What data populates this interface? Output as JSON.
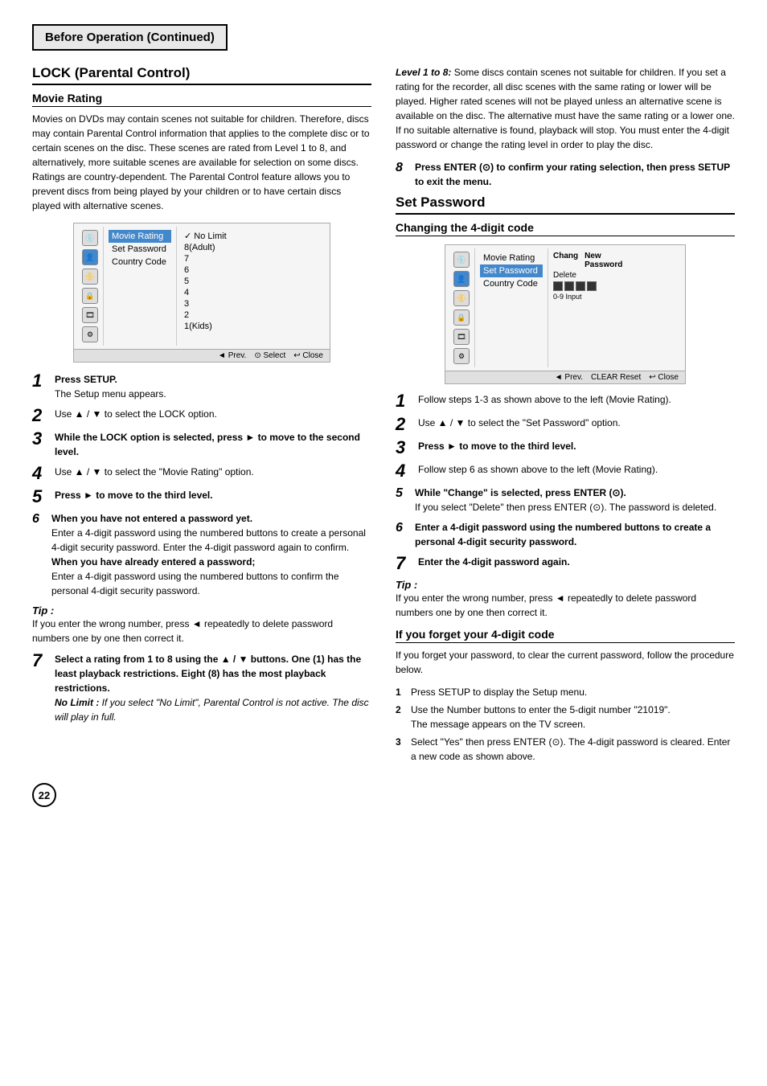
{
  "header": {
    "title": "Before Operation (Continued)"
  },
  "left_col": {
    "section_title": "LOCK (Parental Control)",
    "sub_section_title": "Movie Rating",
    "intro_text": "Movies on DVDs may contain scenes not suitable for children. Therefore, discs may contain Parental Control information that applies to the complete disc or to certain scenes on the disc. These scenes are rated from Level 1 to 8, and alternatively, more suitable scenes are available for selection on some discs. Ratings are country-dependent. The Parental Control feature allows you to prevent discs from being played by your children or to have certain discs played with alternative scenes.",
    "menu": {
      "icons": [
        "disc",
        "person",
        "cd",
        "lock",
        "film",
        "gear"
      ],
      "items": [
        "Movie Rating",
        "Set Password",
        "Country Code"
      ],
      "sub_items": [
        "No Limit",
        "8(Adult)",
        "7",
        "6",
        "5",
        "4",
        "3",
        "2",
        "1(Kids)"
      ],
      "checked_item": "No Limit",
      "bar_items": [
        "◄ Prev.",
        "⊙ Select",
        "↩ Close"
      ]
    },
    "steps": [
      {
        "num": "1",
        "bold": "Press SETUP.",
        "text": "The Setup menu appears."
      },
      {
        "num": "2",
        "text": "Use ▲ / ▼ to select the LOCK option."
      },
      {
        "num": "3",
        "text": "While the LOCK option is selected, press ► to move to the second level."
      },
      {
        "num": "4",
        "text": "Use ▲ / ▼ to select the \"Movie Rating\" option."
      },
      {
        "num": "5",
        "text": "Press ► to move to the third level."
      },
      {
        "num": "6",
        "bold_intro": "When you have not entered a password yet.",
        "text": "Enter a 4-digit password using the numbered buttons to create a personal 4-digit security password. Enter the 4-digit password again to confirm.",
        "bold_alt": "When you have already entered a password;",
        "text_alt": "Enter a 4-digit password using the numbered buttons to confirm the personal 4-digit security password."
      },
      {
        "num": "7",
        "text": "Select a rating from 1 to 8 using the ▲ / ▼ buttons. One (1) has the least playback restrictions. Eight (8) has the most playback restrictions.",
        "note_bold": "No Limit :",
        "note_text": " If you select \"No Limit\", Parental Control is not active. The disc will play in full."
      }
    ],
    "tip": {
      "title": "Tip :",
      "text": "If you enter the wrong number, press ◄ repeatedly to delete password numbers one by one then correct it."
    }
  },
  "right_col": {
    "level_text": "Level 1 to 8: Some discs contain scenes not suitable for children. If you set a rating for the recorder, all disc scenes with the same rating or lower will be played. Higher rated scenes will not be played unless an alternative scene is available on the disc. The alternative must have the same rating or a lower one. If no suitable alternative is found, playback will stop. You must enter the 4-digit password or change the rating level in order to play the disc.",
    "step8": {
      "num": "8",
      "text": "Press ENTER (⊙) to confirm your rating selection, then press SETUP to exit the menu."
    },
    "set_password_title": "Set Password",
    "changing_title": "Changing the 4-digit code",
    "pwd_menu": {
      "items": [
        "Movie Rating",
        "Set Password",
        "Country Code"
      ],
      "sub_items": [
        "Change",
        "Delete"
      ],
      "new_password_label": "New Password",
      "input_squares": 4,
      "hint": "0-9 Input",
      "bar_items": [
        "◄ Prev.",
        "CLEAR Reset",
        "↩ Close"
      ]
    },
    "steps": [
      {
        "num": "1",
        "text": "Follow steps 1-3 as shown above to the left (Movie Rating)."
      },
      {
        "num": "2",
        "text": "Use ▲ / ▼ to select the \"Set Password\" option."
      },
      {
        "num": "3",
        "text": "Press ► to move to the third level."
      },
      {
        "num": "4",
        "text": "Follow step 6 as shown above to the left (Movie Rating)."
      },
      {
        "num": "5",
        "text": "While \"Change\" is selected, press ENTER (⊙).",
        "sub_text": "If you select \"Delete\" then press ENTER (⊙). The password is deleted."
      },
      {
        "num": "6",
        "text": "Enter a 4-digit password using the numbered buttons to create a personal 4-digit security password."
      },
      {
        "num": "7",
        "text": "Enter the 4-digit password again."
      }
    ],
    "tip": {
      "title": "Tip :",
      "text": "If you enter the wrong number, press ◄ repeatedly to delete password numbers one by one then correct it."
    },
    "forget_title": "If you forget your 4-digit code",
    "forget_intro": "If you forget your password, to clear the current password, follow the procedure below.",
    "forget_steps": [
      {
        "num": "1",
        "text": "Press SETUP to display the Setup menu."
      },
      {
        "num": "2",
        "text": "Use the Number buttons to enter the 5-digit number \"21019\".",
        "sub": "The message appears on the TV screen."
      },
      {
        "num": "3",
        "text": "Select \"Yes\" then press ENTER (⊙). The 4-digit password is cleared. Enter a new code as shown above."
      }
    ]
  },
  "page_number": "22"
}
